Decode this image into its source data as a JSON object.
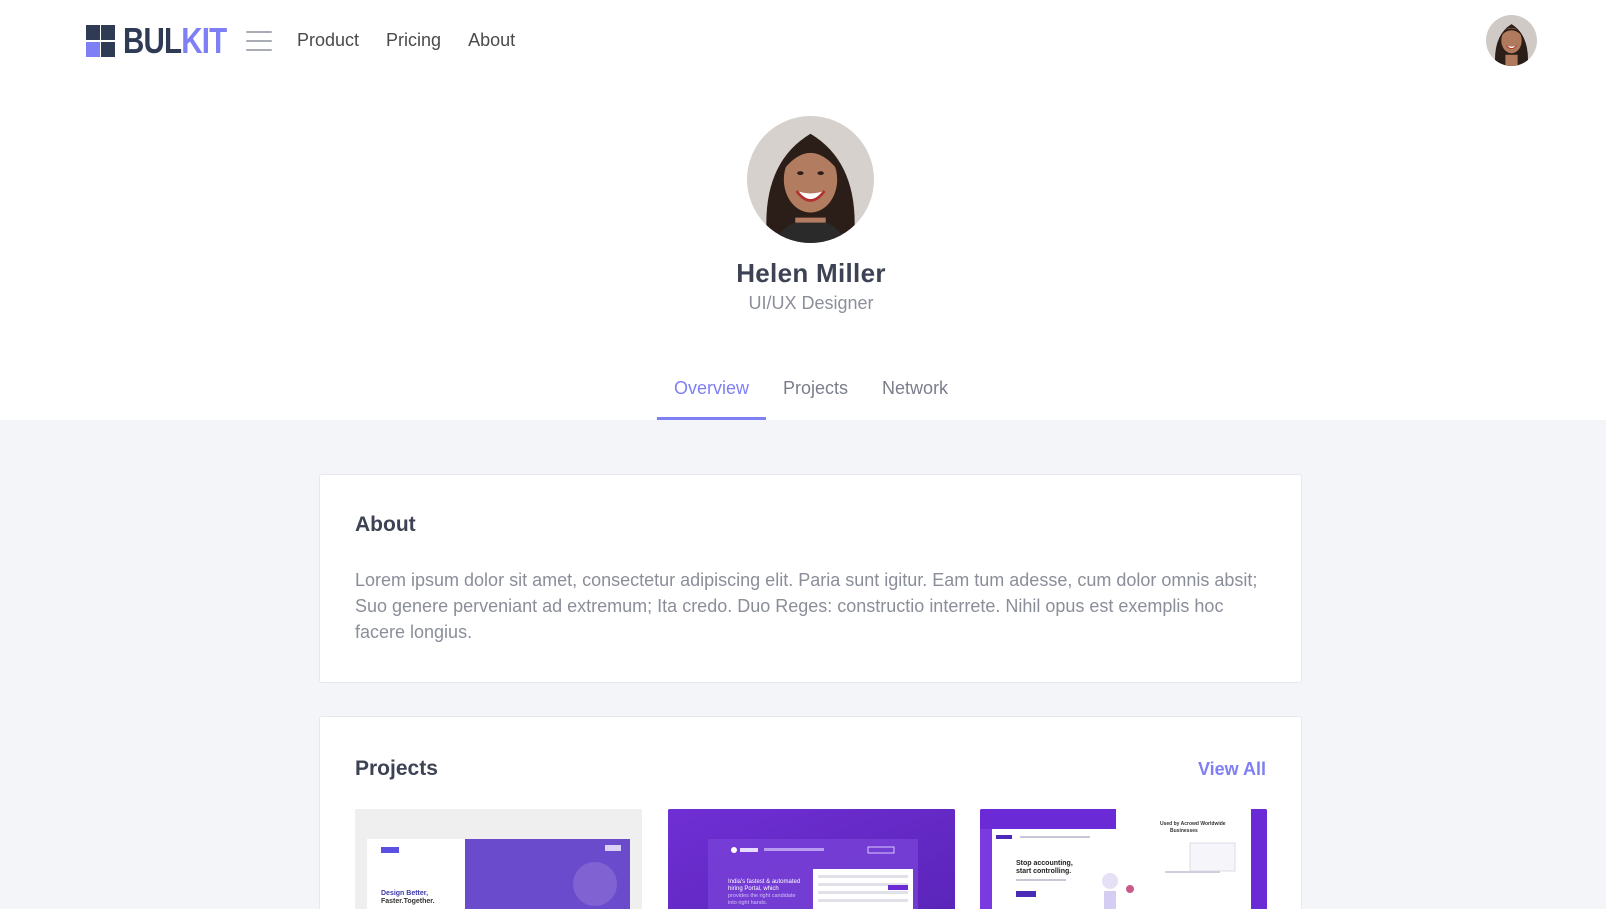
{
  "brand": {
    "logo_dark": "BUL",
    "logo_accent": "KIT",
    "accent_color": "#7f7ff5",
    "dark_color": "#2f3b55"
  },
  "nav": {
    "menu_icon": "hamburger-icon",
    "links": [
      "Product",
      "Pricing",
      "About"
    ]
  },
  "profile": {
    "name": "Helen Miller",
    "role": "UI/UX Designer"
  },
  "tabs": [
    {
      "label": "Overview",
      "active": true
    },
    {
      "label": "Projects",
      "active": false
    },
    {
      "label": "Network",
      "active": false
    }
  ],
  "about": {
    "title": "About",
    "text": "Lorem ipsum dolor sit amet, consectetur adipiscing elit. Paria sunt igitur. Eam tum adesse, cum dolor omnis absit; Suo genere perveniant ad extremum; Ita credo. Duo Reges: constructio interrete. Nihil opus est exemplis hoc facere longius."
  },
  "projects": {
    "title": "Projects",
    "view_all": "View All",
    "thumbs": [
      {
        "heading": "Design Better,\nFaster.Together."
      },
      {
        "heading": "India's fastest & automated hiring Portal, which provides the right candidate into right hands."
      },
      {
        "heading": "Stop accounting, start controlling.",
        "aside": "Used by Acrowd Worldwide Businesses"
      }
    ]
  }
}
